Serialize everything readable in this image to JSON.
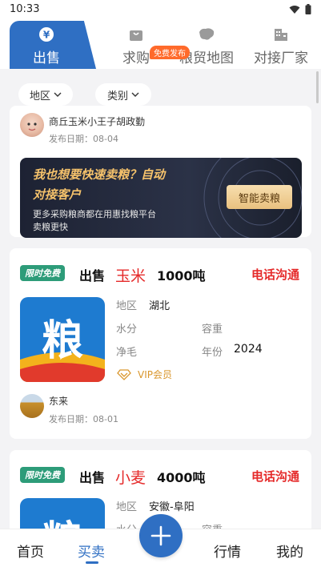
{
  "status_bar": {
    "time": "10:33"
  },
  "top_tabs": {
    "items": [
      {
        "label": "出售",
        "icon": "yen-icon"
      },
      {
        "label": "求购",
        "icon": "shopping-bag-icon"
      },
      {
        "label": "粮贸地图",
        "icon": "map-icon"
      },
      {
        "label": "对接厂家",
        "icon": "building-icon"
      }
    ],
    "active_index": 0,
    "free_badge": "免费发布"
  },
  "filters": {
    "region": "地区",
    "category": "类别"
  },
  "first_card": {
    "poster_name": "商丘玉米小王子胡政勤",
    "date": "发布日期：08-04",
    "banner": {
      "title_line1": "我也想要快速卖粮？自动",
      "title_line2": "对接客户",
      "sub_line1": "更多采购粮商都在用惠找粮平台",
      "sub_line2": "卖粮更快",
      "button": "智能卖粮"
    }
  },
  "listings": [
    {
      "tag": "限时免费",
      "sale": "出售",
      "grain": "玉米",
      "qty": "1000吨",
      "contact": "电话沟通",
      "region_label": "地区",
      "region": "湖北",
      "moisture_label": "水分",
      "moisture": "",
      "weight_label": "容重",
      "weight": "",
      "gross_label": "净毛",
      "gross": "",
      "year_label": "年份",
      "year": "2024",
      "vip": "VIP会员",
      "poster_name": "东来",
      "date": "发布日期：08-01"
    },
    {
      "tag": "限时免费",
      "sale": "出售",
      "grain": "小麦",
      "qty": "4000吨",
      "contact": "电话沟通",
      "region_label": "地区",
      "region": "安徽-阜阳",
      "moisture_label": "水分",
      "weight_label": "容重"
    }
  ],
  "bottom_nav": {
    "items": [
      "首页",
      "买卖",
      "行情",
      "我的"
    ],
    "active_index": 1
  },
  "colors": {
    "brand_blue": "#2f6fc3",
    "accent_red": "#e52a2a",
    "tag_green": "#2d9c79",
    "badge_orange": "#ff6a2b"
  }
}
